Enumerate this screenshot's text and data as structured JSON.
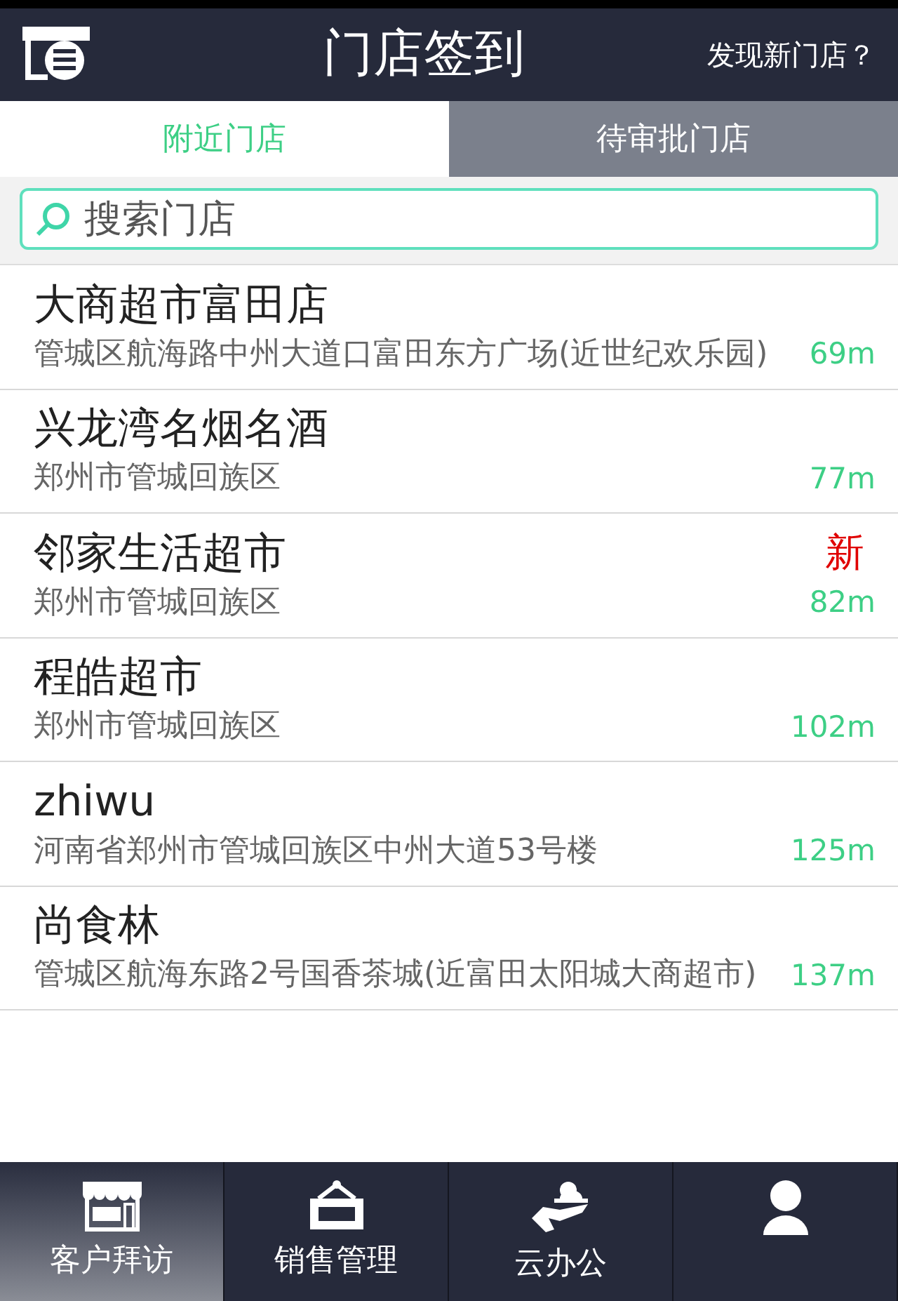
{
  "header": {
    "title": "门店签到",
    "action": "发现新门店？"
  },
  "tabs": [
    {
      "label": "附近门店",
      "selected": true
    },
    {
      "label": "待审批门店",
      "selected": false
    }
  ],
  "search": {
    "placeholder": "搜索门店"
  },
  "stores": [
    {
      "name": "大商超市富田店",
      "address": "管城区航海路中州大道口富田东方广场(近世纪欢乐园)",
      "distance": "69m"
    },
    {
      "name": "兴龙湾名烟名酒",
      "address": "郑州市管城回族区",
      "distance": "77m"
    },
    {
      "name": "邻家生活超市",
      "address": "郑州市管城回族区",
      "distance": "82m",
      "badge": "新"
    },
    {
      "name": "程皓超市",
      "address": "郑州市管城回族区",
      "distance": "102m"
    },
    {
      "name": "zhiwu",
      "address": "河南省郑州市管城回族区中州大道53号楼",
      "distance": "125m"
    },
    {
      "name": "尚食林",
      "address": "管城区航海东路2号国香茶城(近富田太阳城大商超市)",
      "distance": "137m"
    }
  ],
  "nav": [
    {
      "kind": "shop",
      "label": "客户拜访",
      "selected": true
    },
    {
      "kind": "sale",
      "label": "销售管理",
      "selected": false
    },
    {
      "kind": "cloud",
      "label": "云办公",
      "selected": false
    },
    {
      "kind": "person",
      "selected": false
    }
  ]
}
